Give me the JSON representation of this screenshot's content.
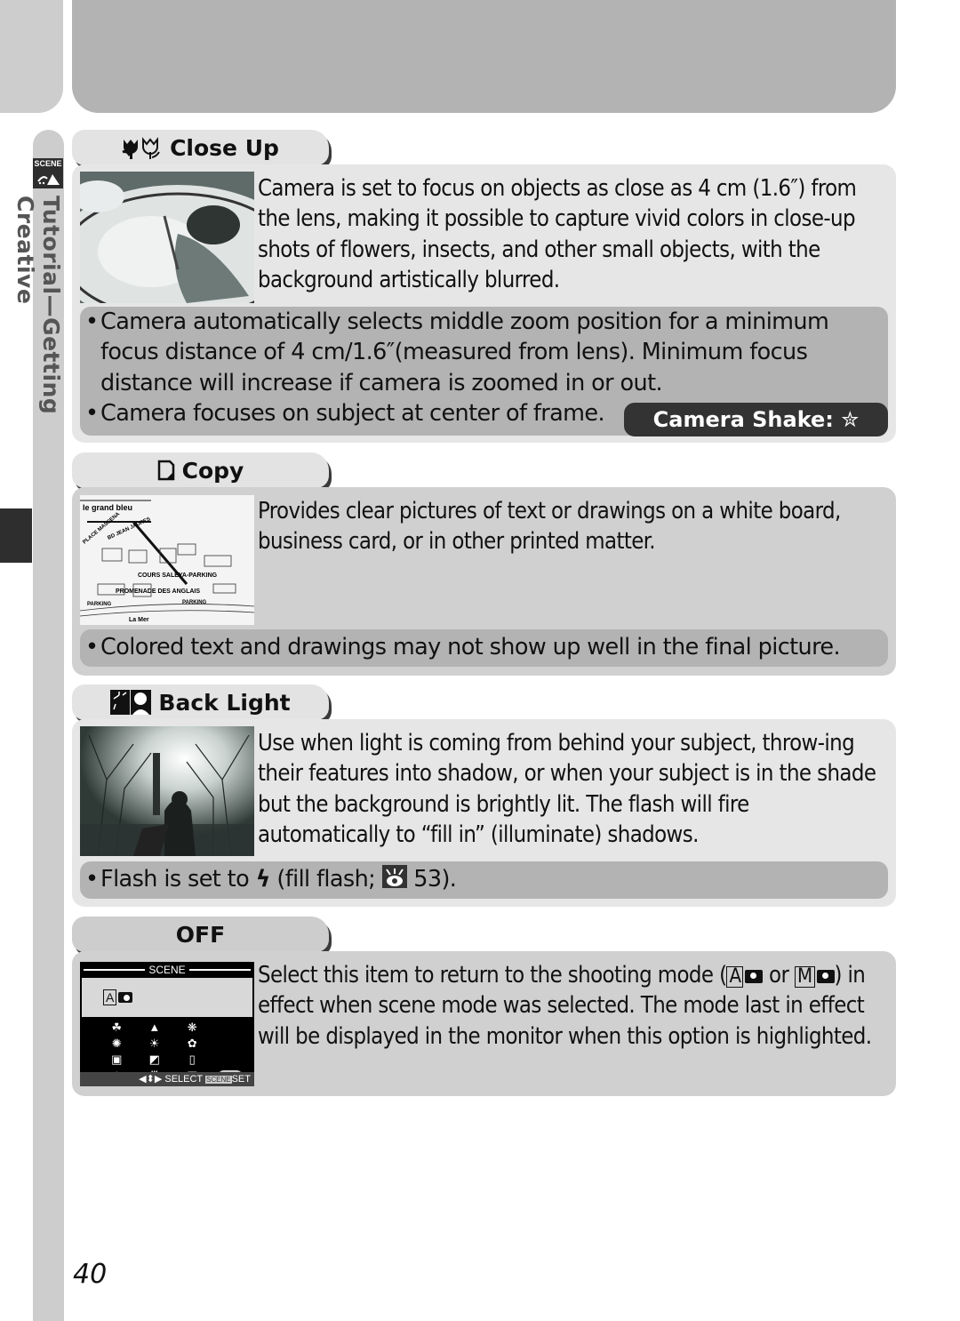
{
  "side": {
    "badge": "SCENE",
    "chapter": "Tutorial—Getting Creative"
  },
  "sections": {
    "close_up": {
      "title": "Close Up",
      "icon": "flower-macro-icon",
      "description": "Camera is set to focus on objects as close as 4 cm (1.6″) from the lens, making it possible to capture vivid colors in close-up shots of flowers, insects, and other small objects, with the background artistically blurred.",
      "notes": [
        "Camera automatically selects middle zoom position for a minimum focus distance of 4 cm/1.6″(measured from lens).  Minimum focus distance will increase if camera is zoomed in or out.",
        "Camera focuses on subject at center of frame."
      ],
      "badge": "Camera Shake: ✮"
    },
    "copy": {
      "title": "Copy",
      "icon": "document-copy-icon",
      "description": "Provides clear pictures of text or drawings on a white board, business card, or in other printed matter.",
      "notes": [
        "Colored text and drawings may not show up well in the final picture."
      ],
      "map_labels": [
        "le grand bleu",
        "PLACE MASSENA",
        "BD JEAN JAURES",
        "COURS SALEYA-PARKING",
        "PROMENADE DES ANGLAIS",
        "PARKING",
        "PARKING",
        "La Mer"
      ]
    },
    "back_light": {
      "title": "Back Light",
      "icon": "backlight-portrait-icon",
      "description": "Use when light is coming from behind your subject, throw-ing their features into shadow, or when your subject is in the shade but the background is brightly lit.  The flash will fire automatically to “fill in” (illuminate) shadows.",
      "note_prefix": "Flash is set to",
      "note_flash_glyph": "ϟ",
      "note_mid": "(fill flash;",
      "note_page": "53)."
    },
    "off": {
      "title": "OFF",
      "description_parts": {
        "p1": "Select this item to return to the shooting mode (",
        "auto_mode": "A",
        "p2": " or",
        "manual_mode": "M",
        "p3": ") in effect when scene mode was selected.  The mode last in effect will be displayed in the monitor when this option is highlighted."
      },
      "lcd": {
        "title": "SCENE",
        "current_mode": "A",
        "footer_select": "◀⬍▶ SELECT",
        "footer_scene": "SCENE",
        "footer_set": "SET",
        "off_label": "OFF",
        "icons": [
          "☘",
          "▲",
          "❋",
          "",
          "✺",
          "☀",
          "✿",
          "",
          "▣",
          "◩",
          "▯",
          "",
          "⛰",
          "Ⅲ",
          "▩",
          "OFF"
        ]
      }
    }
  },
  "page_number": "40"
}
